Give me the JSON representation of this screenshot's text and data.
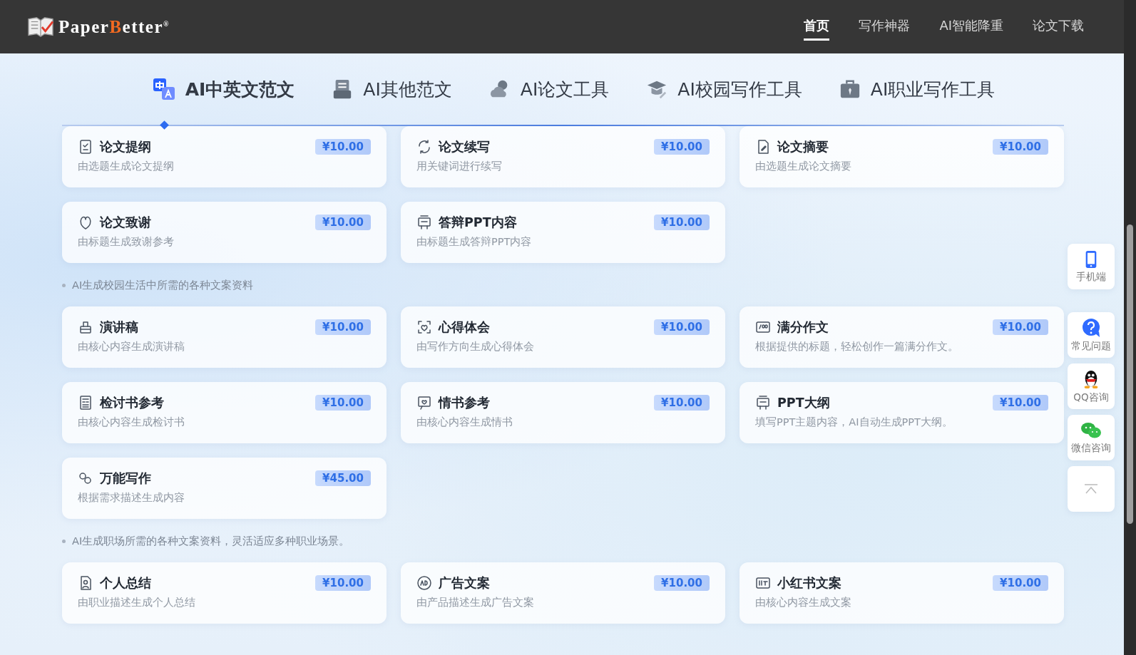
{
  "header": {
    "logo": {
      "before": "Paper",
      "accent": "B",
      "after": "etter",
      "mark": "®"
    },
    "nav": [
      {
        "label": "首页",
        "selected": true
      },
      {
        "label": "写作神器",
        "selected": false
      },
      {
        "label": "AI智能降重",
        "selected": false
      },
      {
        "label": "论文下载",
        "selected": false
      }
    ]
  },
  "tabs": [
    {
      "label": "AI中英文范文",
      "selected": true
    },
    {
      "label": "AI其他范文",
      "selected": false
    },
    {
      "label": "AI论文工具",
      "selected": false
    },
    {
      "label": "AI校园写作工具",
      "selected": false
    },
    {
      "label": "AI职业写作工具",
      "selected": false
    }
  ],
  "sections": [
    {
      "cards": [
        {
          "title": "论文提纲",
          "desc": "由选题生成论文提纲",
          "price": "¥10.00"
        },
        {
          "title": "论文续写",
          "desc": "用关键词进行续写",
          "price": "¥10.00"
        },
        {
          "title": "论文摘要",
          "desc": "由选题生成论文摘要",
          "price": "¥10.00"
        },
        {
          "title": "论文致谢",
          "desc": "由标题生成致谢参考",
          "price": "¥10.00"
        },
        {
          "title": "答辩PPT内容",
          "desc": "由标题生成答辩PPT内容",
          "price": "¥10.00"
        }
      ]
    },
    {
      "note": "AI生成校园生活中所需的各种文案资料",
      "cards": [
        {
          "title": "演讲稿",
          "desc": "由核心内容生成演讲稿",
          "price": "¥10.00"
        },
        {
          "title": "心得体会",
          "desc": "由写作方向生成心得体会",
          "price": "¥10.00"
        },
        {
          "title": "满分作文",
          "desc": "根据提供的标题，轻松创作一篇满分作文。",
          "price": "¥10.00"
        },
        {
          "title": "检讨书参考",
          "desc": "由核心内容生成检讨书",
          "price": "¥10.00"
        },
        {
          "title": "情书参考",
          "desc": "由核心内容生成情书",
          "price": "¥10.00"
        },
        {
          "title": "PPT大纲",
          "desc": "填写PPT主题内容，AI自动生成PPT大纲。",
          "price": "¥10.00"
        },
        {
          "title": "万能写作",
          "desc": "根据需求描述生成内容",
          "price": "¥45.00"
        }
      ]
    },
    {
      "note": "AI生成职场所需的各种文案资料，灵活适应多种职业场景。",
      "cards": [
        {
          "title": "个人总结",
          "desc": "由职业描述生成个人总结",
          "price": "¥10.00"
        },
        {
          "title": "广告文案",
          "desc": "由产品描述生成广告文案",
          "price": "¥10.00"
        },
        {
          "title": "小红书文案",
          "desc": "由核心内容生成文案",
          "price": "¥10.00"
        }
      ]
    }
  ],
  "side": [
    {
      "label": "手机端"
    },
    {
      "label": "常见问题"
    },
    {
      "label": "QQ咨询"
    },
    {
      "label": "微信咨询"
    }
  ]
}
